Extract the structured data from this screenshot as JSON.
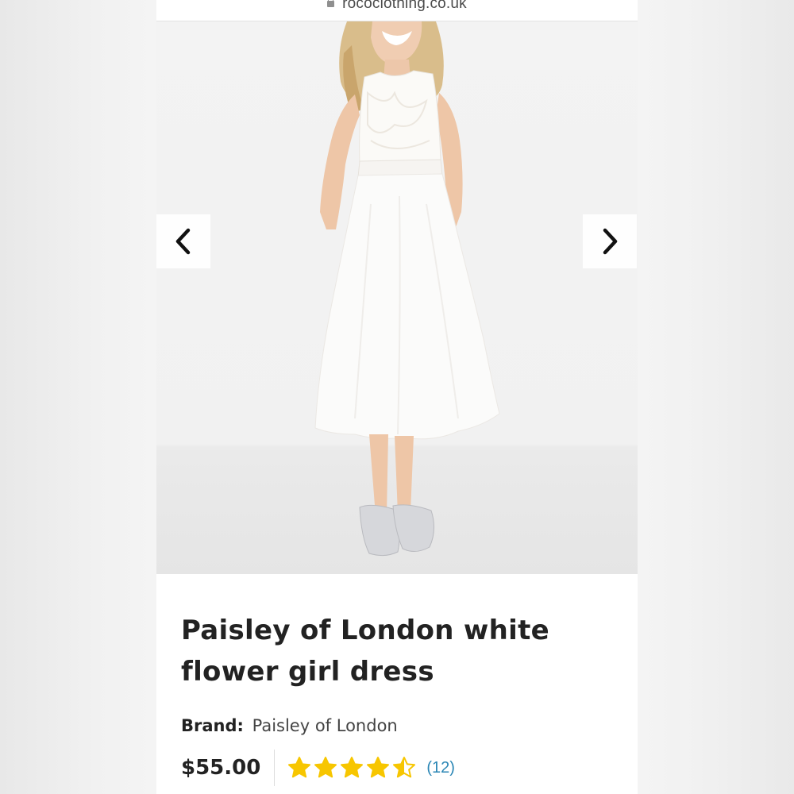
{
  "browser": {
    "url": "rococlothing.co.uk"
  },
  "gallery": {
    "prev_label": "previous image",
    "next_label": "next image"
  },
  "product": {
    "title_line1": "Paisley of London white",
    "title_line2": "flower girl dress",
    "brand_label": "Brand:",
    "brand_value": "Paisley of London",
    "price": "$55.00",
    "rating": 4.5,
    "rating_max": 5,
    "review_count": "(12)"
  },
  "colors": {
    "star": "#f7c600",
    "link": "#2a86b5",
    "text": "#222222"
  },
  "icons": {
    "lock": "lock-icon",
    "prev": "chevron-left-icon",
    "next": "chevron-right-icon",
    "star": "star-icon"
  }
}
